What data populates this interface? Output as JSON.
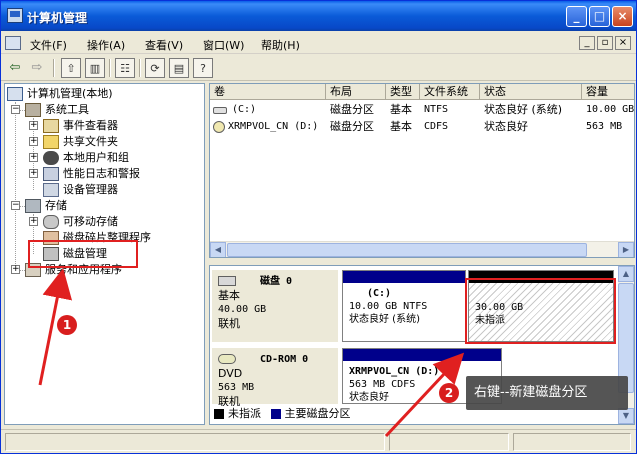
{
  "window": {
    "title": "计算机管理",
    "controls": {
      "minimize": "_",
      "maximize": "□",
      "close": "×"
    }
  },
  "menubar": {
    "items": [
      "文件(F)",
      "操作(A)",
      "查看(V)",
      "窗口(W)",
      "帮助(H)"
    ],
    "mdi_controls": [
      "_",
      "▫",
      "×"
    ]
  },
  "toolbar": {
    "tools": [
      "back-icon",
      "forward-icon",
      "up-icon",
      "show-hide-tree-icon",
      "properties-icon",
      "refresh-icon",
      "export-icon",
      "help-icon"
    ]
  },
  "tree": {
    "nodes": [
      {
        "label": "计算机管理(本地)",
        "icon": "computer-icon"
      },
      {
        "label": "系统工具",
        "icon": "tools-icon"
      },
      {
        "label": "事件查看器",
        "icon": "event-viewer-icon"
      },
      {
        "label": "共享文件夹",
        "icon": "shared-folder-icon"
      },
      {
        "label": "本地用户和组",
        "icon": "users-icon"
      },
      {
        "label": "性能日志和警报",
        "icon": "performance-icon"
      },
      {
        "label": "设备管理器",
        "icon": "device-manager-icon"
      },
      {
        "label": "存储",
        "icon": "storage-icon"
      },
      {
        "label": "可移动存储",
        "icon": "removable-storage-icon"
      },
      {
        "label": "磁盘碎片整理程序",
        "icon": "defrag-icon"
      },
      {
        "label": "磁盘管理",
        "icon": "disk-management-icon"
      },
      {
        "label": "服务和应用程序",
        "icon": "services-icon"
      }
    ]
  },
  "volumes": {
    "columns": [
      "卷",
      "布局",
      "类型",
      "文件系统",
      "状态",
      "容量"
    ],
    "rows": [
      [
        "(C:)",
        "磁盘分区",
        "基本",
        "NTFS",
        "状态良好 (系统)",
        "10.00 GB"
      ],
      [
        "XRMPVOL_CN (D:)",
        "磁盘分区",
        "基本",
        "CDFS",
        "状态良好",
        "563 MB"
      ]
    ]
  },
  "disks": [
    {
      "name": "磁盘 0",
      "type": "基本",
      "size": "40.00 GB",
      "status": "联机",
      "partitions": [
        {
          "label": "(C:)",
          "detail": "10.00 GB NTFS",
          "status": "状态良好 (系统)"
        },
        {
          "label": "",
          "detail": "30.00 GB",
          "status": "未指派"
        }
      ]
    },
    {
      "name": "CD-ROM 0",
      "type": "DVD",
      "size": "563 MB",
      "status": "联机",
      "partitions": [
        {
          "label": "XRMPVOL_CN (D:)",
          "detail": "563 MB CDFS",
          "status": "状态良好"
        }
      ]
    }
  ],
  "legend": [
    {
      "label": "未指派",
      "color": "#000000"
    },
    {
      "label": "主要磁盘分区",
      "color": "#00008B"
    }
  ],
  "annotations": {
    "step1": "1",
    "step2": "2",
    "tip": "右键--新建磁盘分区",
    "color": "#E02020"
  }
}
